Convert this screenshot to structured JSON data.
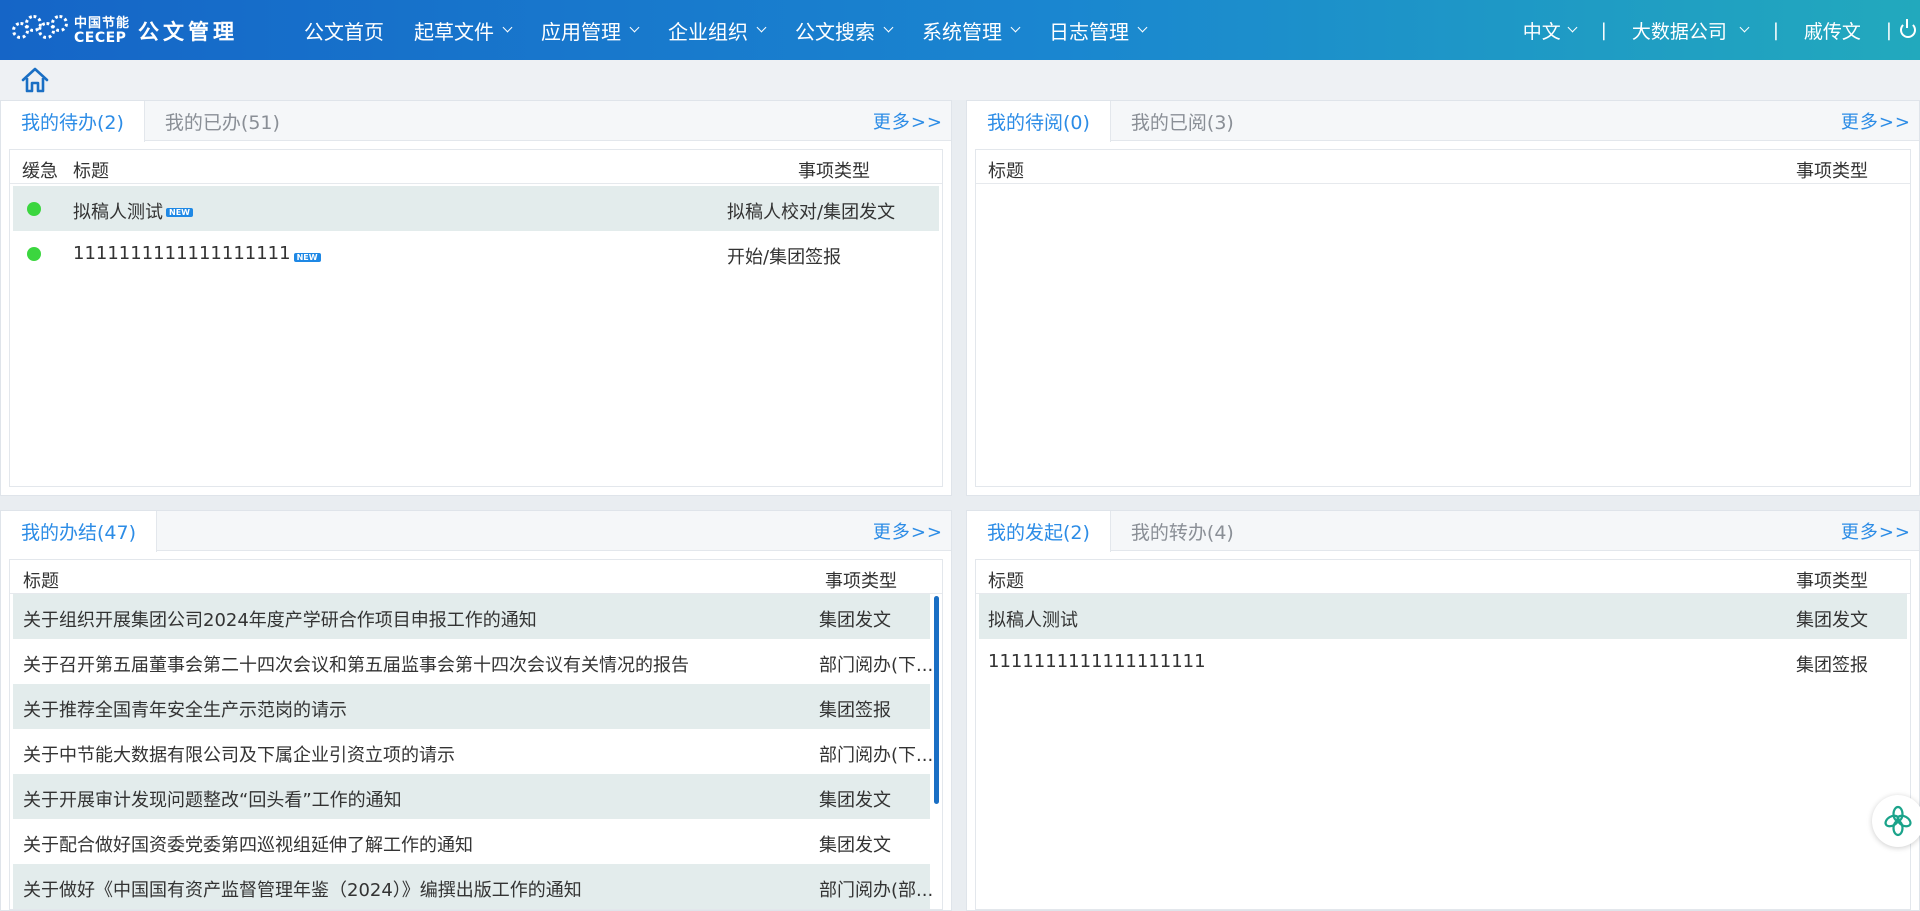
{
  "brand": {
    "cn": "中国节能",
    "en": "CECEP",
    "title": "公文管理"
  },
  "nav": [
    {
      "label": "公文首页",
      "has_menu": false
    },
    {
      "label": "起草文件",
      "has_menu": true
    },
    {
      "label": "应用管理",
      "has_menu": true
    },
    {
      "label": "企业组织",
      "has_menu": true
    },
    {
      "label": "公文搜索",
      "has_menu": true
    },
    {
      "label": "系统管理",
      "has_menu": true
    },
    {
      "label": "日志管理",
      "has_menu": true
    }
  ],
  "topright": {
    "language": "中文",
    "company": "大数据公司",
    "user": "戚传文",
    "separator": "|"
  },
  "more_label": "更多>>",
  "panel_todo": {
    "tabs": [
      "我的待办(2)",
      "我的已办(51)"
    ],
    "headers": {
      "urgency": "缓急",
      "title": "标题",
      "type": "事项类型"
    },
    "rows": [
      {
        "title": "拟稿人测试",
        "type": "拟稿人校对/集团发文",
        "badge": "NEW",
        "status_color": "#3bd63f"
      },
      {
        "title": "1111111111111111111",
        "type": "开始/集团签报",
        "badge": "NEW",
        "status_color": "#3bd63f"
      }
    ]
  },
  "panel_toread": {
    "tabs": [
      "我的待阅(0)",
      "我的已阅(3)"
    ],
    "headers": {
      "title": "标题",
      "type": "事项类型"
    }
  },
  "panel_done": {
    "tabs": [
      "我的办结(47)"
    ],
    "headers": {
      "title": "标题",
      "type": "事项类型"
    },
    "rows": [
      {
        "title": "关于组织开展集团公司2024年度产学研合作项目申报工作的通知",
        "type": "集团发文"
      },
      {
        "title": "关于召开第五届董事会第二十四次会议和第五届监事会第十四次会议有关情况的报告",
        "type": "部门阅办(下..."
      },
      {
        "title": "关于推荐全国青年安全生产示范岗的请示",
        "type": "集团签报"
      },
      {
        "title": "关于中节能大数据有限公司及下属企业引资立项的请示",
        "type": "部门阅办(下..."
      },
      {
        "title": "关于开展审计发现问题整改“回头看”工作的通知",
        "type": "集团发文"
      },
      {
        "title": "关于配合做好国资委党委第四巡视组延伸了解工作的通知",
        "type": "集团发文"
      },
      {
        "title": "关于做好《中国国有资产监督管理年鉴（2024）》编撰出版工作的通知",
        "type": "部门阅办(部..."
      }
    ]
  },
  "panel_started": {
    "tabs": [
      "我的发起(2)",
      "我的转办(4)"
    ],
    "headers": {
      "title": "标题",
      "type": "事项类型"
    },
    "rows": [
      {
        "title": "拟稿人测试",
        "type": "集团发文"
      },
      {
        "title": "1111111111111111111",
        "type": "集团签报"
      }
    ]
  },
  "colors": {
    "accent": "#2c8ce6",
    "header_start": "#1565c7",
    "header_end": "#22a9bd",
    "row_stripe": "#e3ecec",
    "status_green": "#3bd63f"
  }
}
